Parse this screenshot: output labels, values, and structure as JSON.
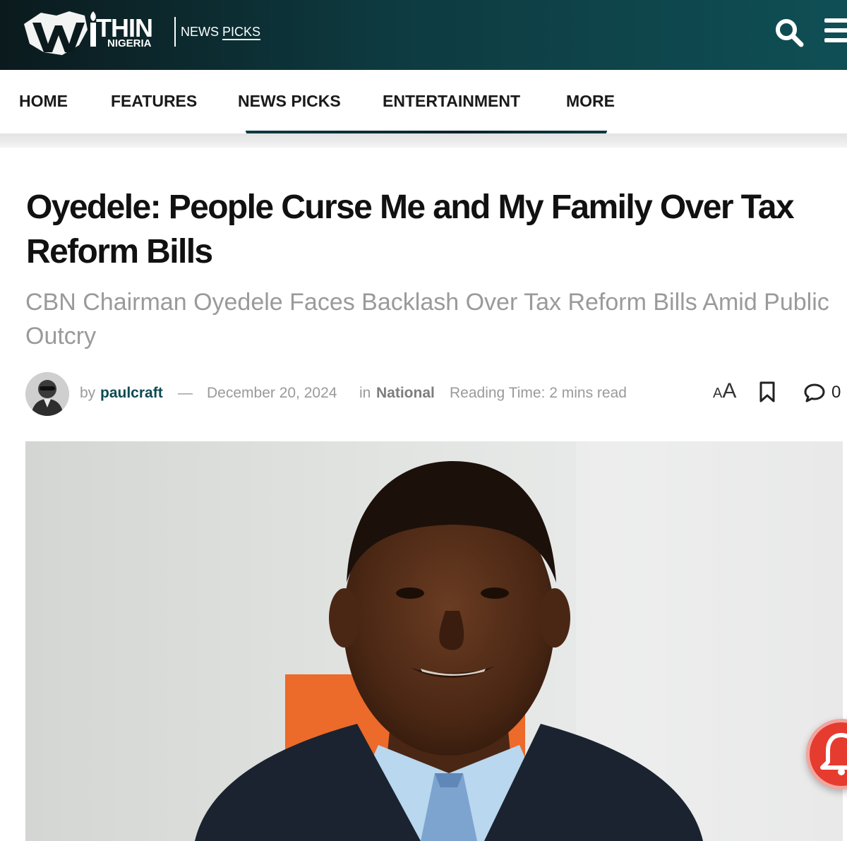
{
  "header": {
    "logo_thin": "THIN",
    "logo_nigeria": "NIGERIA",
    "section_news": "NEWS",
    "section_picks": "PICKS",
    "search_icon": "search-icon",
    "menu_icon": "hamburger-menu-icon",
    "background_color": "#0d3a40"
  },
  "nav": {
    "items": [
      {
        "label": "HOME"
      },
      {
        "label": "FEATURES"
      },
      {
        "label": "NEWS PICKS"
      },
      {
        "label": "ENTERTAINMENT"
      },
      {
        "label": "MORE"
      }
    ],
    "active_index": 2
  },
  "article": {
    "title": "Oyedele: People Curse Me and My Family Over Tax Reform Bills",
    "subtitle": "CBN Chairman Oyedele Faces Backlash Over Tax Reform Bills Amid Public Outcry",
    "meta": {
      "by": "by",
      "author": "paulcraft",
      "dash": "—",
      "date": "December 20, 2024",
      "in": "in",
      "category": "National",
      "reading_time": "Reading Time: 2 mins read",
      "font_small": "A",
      "font_big": "A",
      "comment_count": "0"
    }
  },
  "notification": {
    "icon": "bell-icon",
    "color": "#e53c2f"
  }
}
